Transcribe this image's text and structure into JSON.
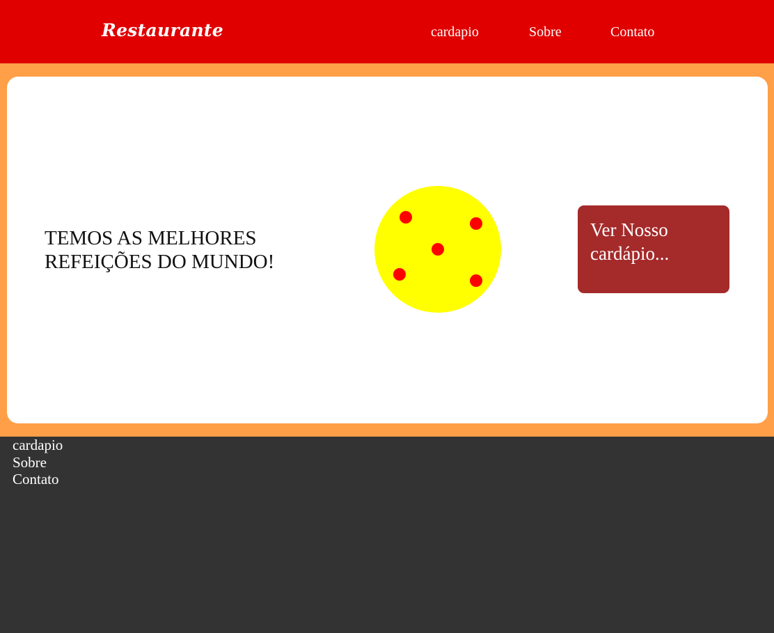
{
  "header": {
    "brand": "Restaurante",
    "nav": [
      "cardapio",
      "Sobre",
      "Contato"
    ]
  },
  "hero": {
    "headline": "TEMOS AS MELHORES REFEIÇÕES DO MUNDO!",
    "cta_label": "Ver Nosso cardápio..."
  },
  "footer": {
    "links": [
      "cardapio",
      "Sobre",
      "Contato"
    ]
  },
  "colors": {
    "header_bg": "#e00000",
    "hero_band": "#ff9f47",
    "card_bg": "#ffffff",
    "pizza_base": "#ffff00",
    "pizza_topping": "#ff0000",
    "cta_bg": "#a52a2a",
    "footer_bg": "#333333"
  }
}
